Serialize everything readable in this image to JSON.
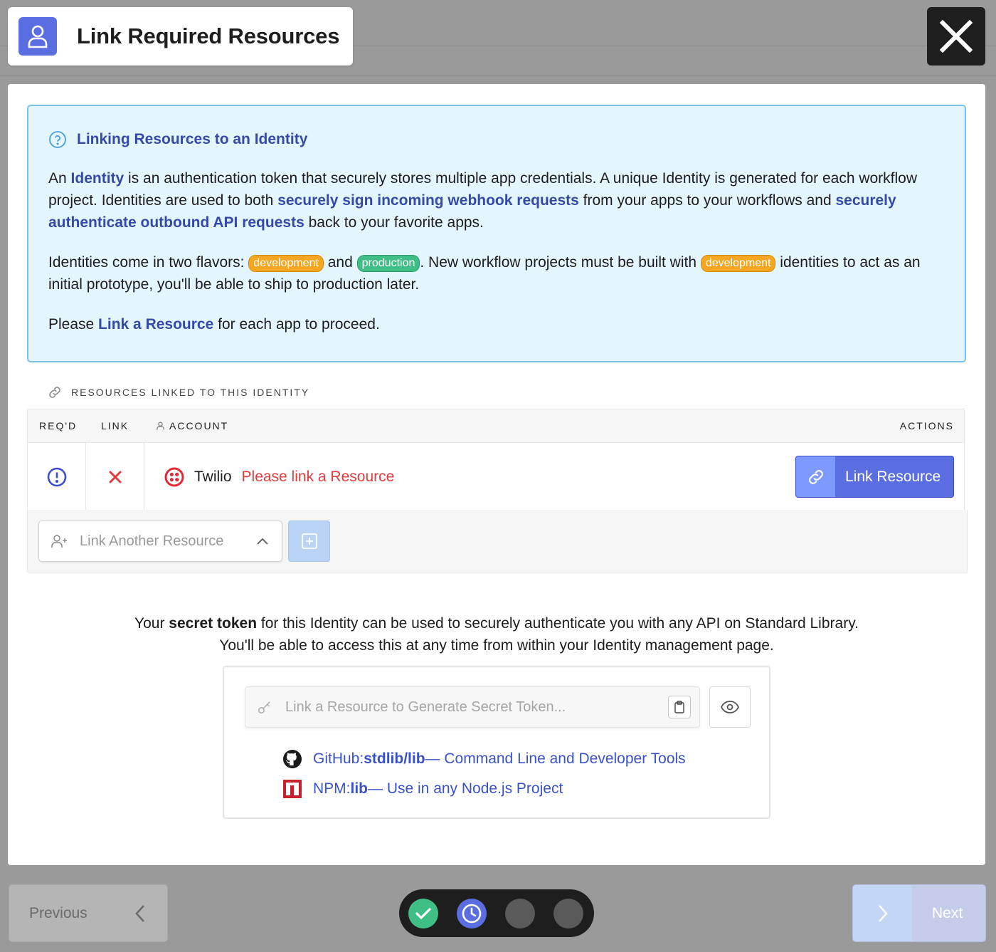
{
  "header": {
    "title": "Link Required Resources",
    "icon": "user-icon",
    "accent": "#5b6ee1"
  },
  "close": {
    "icon": "close-icon"
  },
  "info": {
    "heading": "Linking Resources to an Identity",
    "p1_a": "An ",
    "p1_link1": "Identity",
    "p1_b": " is an authentication token that securely stores multiple app credentials. A unique Identity is generated for each workflow project. Identities are used to both ",
    "p1_link2": "securely sign incoming webhook requests",
    "p1_c": " from your apps to your workflows and ",
    "p1_link3": "securely authenticate outbound API requests",
    "p1_d": " back to your favorite apps.",
    "p2_a": "Identities come in two flavors: ",
    "tag_dev": "development",
    "p2_b": " and ",
    "tag_prod": "production",
    "p2_c": ". New workflow projects must be built with ",
    "p2_d": " identities to act as an initial prototype, you'll be able to ship to production later.",
    "p3_a": "Please ",
    "p3_link": "Link a Resource",
    "p3_b": " for each app to proceed."
  },
  "resources": {
    "section_title": "RESOURCES LINKED TO THIS IDENTITY",
    "columns": {
      "reqd": "REQ'D",
      "link": "LINK",
      "account": "ACCOUNT",
      "actions": "ACTIONS"
    },
    "rows": [
      {
        "account": "Twilio",
        "status": "Please link a Resource",
        "action": "Link Resource"
      }
    ],
    "another_placeholder": "Link Another Resource"
  },
  "secret": {
    "line1_a": "Your ",
    "line1_b": "secret token",
    "line1_c": " for this Identity can be used to securely authenticate you with any API on Standard Library.",
    "line2": "You'll be able to access this at any time from within your Identity management page.",
    "token_placeholder": "Link a Resource to Generate Secret Token...",
    "github_a": "GitHub: ",
    "github_b": "stdlib/lib",
    "github_c": " — Command Line and Developer Tools",
    "npm_a": "NPM: ",
    "npm_b": "lib",
    "npm_c": " — Use in any Node.js Project"
  },
  "nav": {
    "previous": "Previous",
    "next": "Next",
    "steps": [
      "done",
      "active",
      "pending",
      "pending"
    ]
  }
}
